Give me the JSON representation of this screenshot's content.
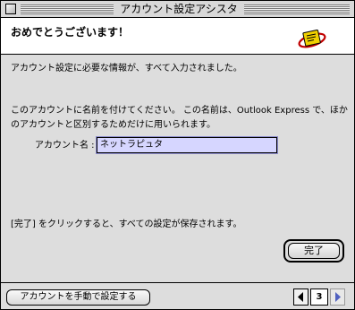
{
  "window": {
    "title": "アカウント設定アシスタント"
  },
  "header": {
    "title": "おめでとうございます！",
    "icon": "mail-icon"
  },
  "content": {
    "line1": "アカウント設定に必要な情報が、すべて入力されました。",
    "line2": "このアカウントに名前を付けてください。 この名前は、Outlook Express で、ほかのアカウントと区別するためだけに用いられます。",
    "account_name_label": "アカウント名 :",
    "account_name_value": "ネットラピュタ",
    "line3": "[完了] をクリックすると、すべての設定が保存されます。"
  },
  "buttons": {
    "finish": "完了",
    "manual_setup": "アカウントを手動で設定する"
  },
  "pager": {
    "page": "3"
  }
}
